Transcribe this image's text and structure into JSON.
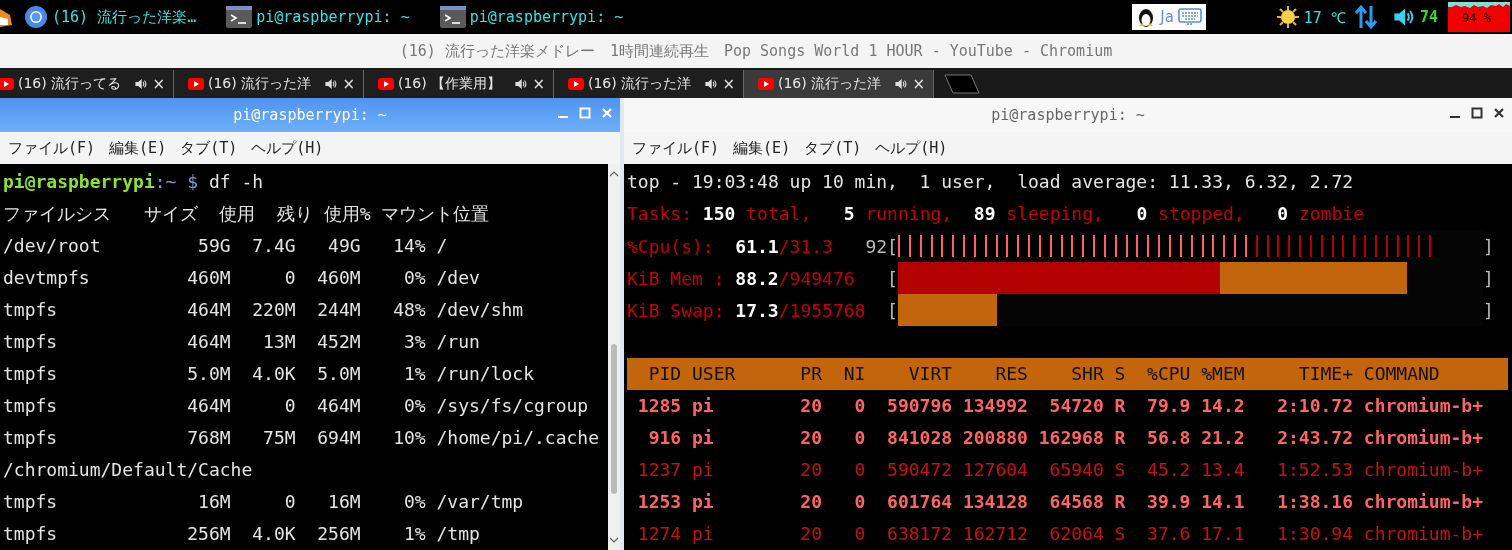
{
  "taskbar": {
    "tasks": [
      {
        "kind": "browser",
        "label": "(16) 流行った洋楽…"
      },
      {
        "kind": "terminal",
        "label": "pi@raspberrypi: ~"
      },
      {
        "kind": "terminal",
        "label": "pi@raspberrypi: ~"
      }
    ],
    "tray": {
      "input_method": "Ja",
      "temperature": "17 ℃",
      "volume": "74",
      "cpu_usage": "94 %"
    }
  },
  "browser": {
    "title": "(16) 流行った洋楽メドレー　1時間連続再生　Pop Songs World 1 HOUR - YouTube - Chromium",
    "tabs": [
      {
        "title": "(16) 流行ってる",
        "close": "×",
        "selected": false
      },
      {
        "title": "(16) 流行った洋",
        "close": "×",
        "selected": false
      },
      {
        "title": "(16) 【作業用】",
        "close": "×",
        "selected": false
      },
      {
        "title": "(16) 流行った洋",
        "close": "×",
        "selected": false
      },
      {
        "title": "(16) 流行った洋",
        "close": "×",
        "selected": true
      }
    ]
  },
  "left_terminal": {
    "title": "pi@raspberrypi: ~",
    "active": true,
    "menu": [
      "ファイル(F)",
      "編集(E)",
      "タブ(T)",
      "ヘルプ(H)"
    ],
    "prompt": {
      "user_host": "pi@raspberrypi",
      "path": ":~",
      "symbol": "$",
      "command": "df -h"
    },
    "lines": [
      "ファイルシス   サイズ  使用  残り 使用% マウント位置",
      "/dev/root         59G  7.4G   49G   14% /",
      "devtmpfs         460M     0  460M    0% /dev",
      "tmpfs            464M  220M  244M   48% /dev/shm",
      "tmpfs            464M   13M  452M    3% /run",
      "tmpfs            5.0M  4.0K  5.0M    1% /run/lock",
      "tmpfs            464M     0  464M    0% /sys/fs/cgroup",
      "tmpfs            768M   75M  694M   10% /home/pi/.cache",
      "/chromium/Default/Cache",
      "tmpfs             16M     0   16M    0% /var/tmp",
      "tmpfs            256M  4.0K  256M    1% /tmp"
    ]
  },
  "right_terminal": {
    "title": "pi@raspberrypi: ~",
    "active": false,
    "menu": [
      "ファイル(F)",
      "編集(E)",
      "タブ(T)",
      "ヘルプ(H)"
    ],
    "summary": [
      {
        "segments": [
          {
            "kind": "plain",
            "text": "top - 19:03:48 up 10 min,  1 user,  load average: 11.33, 6.32, 2.72"
          }
        ]
      },
      {
        "segments": [
          {
            "kind": "label",
            "text": "Tasks:"
          },
          {
            "kind": "value",
            "text": " 150"
          },
          {
            "kind": "label",
            "text": " total,"
          },
          {
            "kind": "value",
            "text": "   5"
          },
          {
            "kind": "label",
            "text": " running,"
          },
          {
            "kind": "value",
            "text": "  89"
          },
          {
            "kind": "label",
            "text": " sleeping,"
          },
          {
            "kind": "value",
            "text": "   0"
          },
          {
            "kind": "label",
            "text": " stopped,"
          },
          {
            "kind": "value",
            "text": "   0"
          },
          {
            "kind": "label",
            "text": " zombie"
          }
        ]
      }
    ],
    "meters": [
      {
        "label": "%Cpu(s):",
        "value": "61.1",
        "detail": "/31.3",
        "prefix": "92",
        "open": "[",
        "close": "]",
        "segments": [
          {
            "kind": "bright_ticks",
            "level": 0.611
          },
          {
            "kind": "dim_ticks",
            "level": 0.924
          }
        ]
      },
      {
        "label": "KiB Mem :",
        "value": "88.2",
        "detail": "/949476",
        "open": "[",
        "close": "]",
        "segments": [
          {
            "kind": "red",
            "level": 0.55
          },
          {
            "kind": "orange",
            "level": 0.87
          }
        ]
      },
      {
        "label": "KiB Swap:",
        "value": "17.3",
        "detail": "/1955768",
        "open": "[",
        "close": "]",
        "segments": [
          {
            "kind": "orange",
            "level": 0.17
          }
        ]
      }
    ],
    "processes": {
      "columns": [
        "PID",
        "USER",
        "PR",
        "NI",
        "VIRT",
        "RES",
        "SHR",
        "S",
        "%CPU",
        "%MEM",
        "TIME+",
        "COMMAND"
      ],
      "rows": [
        {
          "highlighted": true,
          "cells": [
            "1285",
            "pi",
            "20",
            "0",
            "590796",
            "134992",
            "54720",
            "R",
            "79.9",
            "14.2",
            "2:10.72",
            "chromium-b+"
          ]
        },
        {
          "highlighted": true,
          "cells": [
            "916",
            "pi",
            "20",
            "0",
            "841028",
            "200880",
            "162968",
            "R",
            "56.8",
            "21.2",
            "2:43.72",
            "chromium-b+"
          ]
        },
        {
          "highlighted": false,
          "cells": [
            "1237",
            "pi",
            "20",
            "0",
            "590472",
            "127604",
            "65940",
            "S",
            "45.2",
            "13.4",
            "1:52.53",
            "chromium-b+"
          ]
        },
        {
          "highlighted": true,
          "cells": [
            "1253",
            "pi",
            "20",
            "0",
            "601764",
            "134128",
            "64568",
            "R",
            "39.9",
            "14.1",
            "1:38.16",
            "chromium-b+"
          ]
        },
        {
          "highlighted": false,
          "cells": [
            "1274",
            "pi",
            "20",
            "0",
            "638172",
            "162712",
            "62064",
            "S",
            "37.6",
            "17.1",
            "1:30.94",
            "chromium-b+"
          ]
        }
      ]
    }
  }
}
